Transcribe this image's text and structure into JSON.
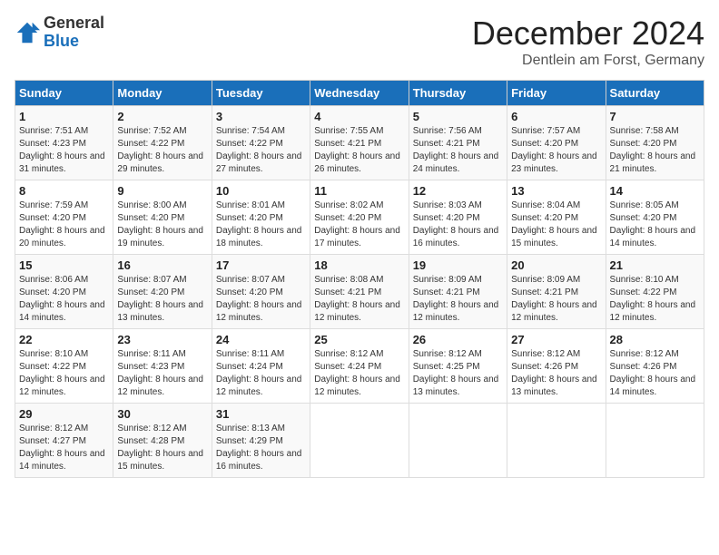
{
  "logo": {
    "line1": "General",
    "line2": "Blue"
  },
  "title": "December 2024",
  "location": "Dentlein am Forst, Germany",
  "days_of_week": [
    "Sunday",
    "Monday",
    "Tuesday",
    "Wednesday",
    "Thursday",
    "Friday",
    "Saturday"
  ],
  "weeks": [
    [
      {
        "day": "1",
        "sunrise": "Sunrise: 7:51 AM",
        "sunset": "Sunset: 4:23 PM",
        "daylight": "Daylight: 8 hours and 31 minutes."
      },
      {
        "day": "2",
        "sunrise": "Sunrise: 7:52 AM",
        "sunset": "Sunset: 4:22 PM",
        "daylight": "Daylight: 8 hours and 29 minutes."
      },
      {
        "day": "3",
        "sunrise": "Sunrise: 7:54 AM",
        "sunset": "Sunset: 4:22 PM",
        "daylight": "Daylight: 8 hours and 27 minutes."
      },
      {
        "day": "4",
        "sunrise": "Sunrise: 7:55 AM",
        "sunset": "Sunset: 4:21 PM",
        "daylight": "Daylight: 8 hours and 26 minutes."
      },
      {
        "day": "5",
        "sunrise": "Sunrise: 7:56 AM",
        "sunset": "Sunset: 4:21 PM",
        "daylight": "Daylight: 8 hours and 24 minutes."
      },
      {
        "day": "6",
        "sunrise": "Sunrise: 7:57 AM",
        "sunset": "Sunset: 4:20 PM",
        "daylight": "Daylight: 8 hours and 23 minutes."
      },
      {
        "day": "7",
        "sunrise": "Sunrise: 7:58 AM",
        "sunset": "Sunset: 4:20 PM",
        "daylight": "Daylight: 8 hours and 21 minutes."
      }
    ],
    [
      {
        "day": "8",
        "sunrise": "Sunrise: 7:59 AM",
        "sunset": "Sunset: 4:20 PM",
        "daylight": "Daylight: 8 hours and 20 minutes."
      },
      {
        "day": "9",
        "sunrise": "Sunrise: 8:00 AM",
        "sunset": "Sunset: 4:20 PM",
        "daylight": "Daylight: 8 hours and 19 minutes."
      },
      {
        "day": "10",
        "sunrise": "Sunrise: 8:01 AM",
        "sunset": "Sunset: 4:20 PM",
        "daylight": "Daylight: 8 hours and 18 minutes."
      },
      {
        "day": "11",
        "sunrise": "Sunrise: 8:02 AM",
        "sunset": "Sunset: 4:20 PM",
        "daylight": "Daylight: 8 hours and 17 minutes."
      },
      {
        "day": "12",
        "sunrise": "Sunrise: 8:03 AM",
        "sunset": "Sunset: 4:20 PM",
        "daylight": "Daylight: 8 hours and 16 minutes."
      },
      {
        "day": "13",
        "sunrise": "Sunrise: 8:04 AM",
        "sunset": "Sunset: 4:20 PM",
        "daylight": "Daylight: 8 hours and 15 minutes."
      },
      {
        "day": "14",
        "sunrise": "Sunrise: 8:05 AM",
        "sunset": "Sunset: 4:20 PM",
        "daylight": "Daylight: 8 hours and 14 minutes."
      }
    ],
    [
      {
        "day": "15",
        "sunrise": "Sunrise: 8:06 AM",
        "sunset": "Sunset: 4:20 PM",
        "daylight": "Daylight: 8 hours and 14 minutes."
      },
      {
        "day": "16",
        "sunrise": "Sunrise: 8:07 AM",
        "sunset": "Sunset: 4:20 PM",
        "daylight": "Daylight: 8 hours and 13 minutes."
      },
      {
        "day": "17",
        "sunrise": "Sunrise: 8:07 AM",
        "sunset": "Sunset: 4:20 PM",
        "daylight": "Daylight: 8 hours and 12 minutes."
      },
      {
        "day": "18",
        "sunrise": "Sunrise: 8:08 AM",
        "sunset": "Sunset: 4:21 PM",
        "daylight": "Daylight: 8 hours and 12 minutes."
      },
      {
        "day": "19",
        "sunrise": "Sunrise: 8:09 AM",
        "sunset": "Sunset: 4:21 PM",
        "daylight": "Daylight: 8 hours and 12 minutes."
      },
      {
        "day": "20",
        "sunrise": "Sunrise: 8:09 AM",
        "sunset": "Sunset: 4:21 PM",
        "daylight": "Daylight: 8 hours and 12 minutes."
      },
      {
        "day": "21",
        "sunrise": "Sunrise: 8:10 AM",
        "sunset": "Sunset: 4:22 PM",
        "daylight": "Daylight: 8 hours and 12 minutes."
      }
    ],
    [
      {
        "day": "22",
        "sunrise": "Sunrise: 8:10 AM",
        "sunset": "Sunset: 4:22 PM",
        "daylight": "Daylight: 8 hours and 12 minutes."
      },
      {
        "day": "23",
        "sunrise": "Sunrise: 8:11 AM",
        "sunset": "Sunset: 4:23 PM",
        "daylight": "Daylight: 8 hours and 12 minutes."
      },
      {
        "day": "24",
        "sunrise": "Sunrise: 8:11 AM",
        "sunset": "Sunset: 4:24 PM",
        "daylight": "Daylight: 8 hours and 12 minutes."
      },
      {
        "day": "25",
        "sunrise": "Sunrise: 8:12 AM",
        "sunset": "Sunset: 4:24 PM",
        "daylight": "Daylight: 8 hours and 12 minutes."
      },
      {
        "day": "26",
        "sunrise": "Sunrise: 8:12 AM",
        "sunset": "Sunset: 4:25 PM",
        "daylight": "Daylight: 8 hours and 13 minutes."
      },
      {
        "day": "27",
        "sunrise": "Sunrise: 8:12 AM",
        "sunset": "Sunset: 4:26 PM",
        "daylight": "Daylight: 8 hours and 13 minutes."
      },
      {
        "day": "28",
        "sunrise": "Sunrise: 8:12 AM",
        "sunset": "Sunset: 4:26 PM",
        "daylight": "Daylight: 8 hours and 14 minutes."
      }
    ],
    [
      {
        "day": "29",
        "sunrise": "Sunrise: 8:12 AM",
        "sunset": "Sunset: 4:27 PM",
        "daylight": "Daylight: 8 hours and 14 minutes."
      },
      {
        "day": "30",
        "sunrise": "Sunrise: 8:12 AM",
        "sunset": "Sunset: 4:28 PM",
        "daylight": "Daylight: 8 hours and 15 minutes."
      },
      {
        "day": "31",
        "sunrise": "Sunrise: 8:13 AM",
        "sunset": "Sunset: 4:29 PM",
        "daylight": "Daylight: 8 hours and 16 minutes."
      },
      null,
      null,
      null,
      null
    ]
  ]
}
